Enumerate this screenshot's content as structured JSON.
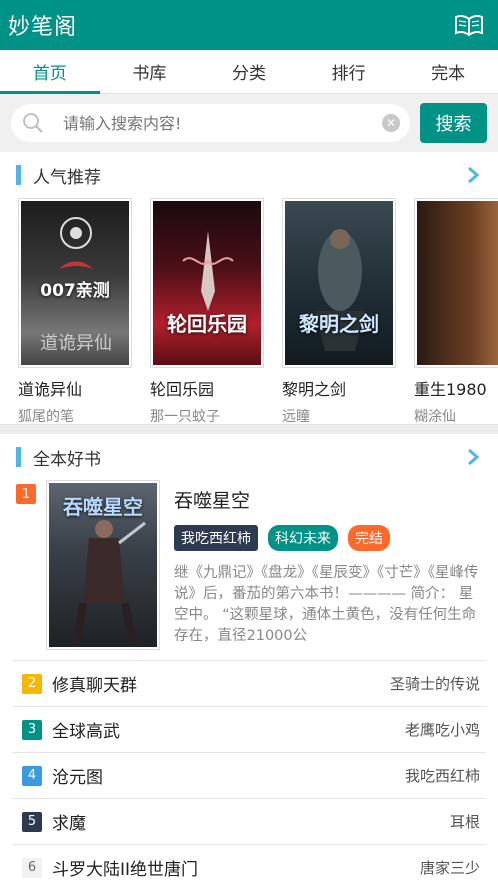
{
  "app": {
    "title": "妙笔阁",
    "library_icon": "open-book-icon"
  },
  "tabs": [
    {
      "label": "首页",
      "active": true
    },
    {
      "label": "书库",
      "active": false
    },
    {
      "label": "分类",
      "active": false
    },
    {
      "label": "排行",
      "active": false
    },
    {
      "label": "完本",
      "active": false
    }
  ],
  "search": {
    "placeholder": "请输入搜索内容!",
    "button_label": "搜索"
  },
  "popular": {
    "heading": "人气推荐",
    "books": [
      {
        "name": "道诡异仙",
        "author": "狐尾的笔",
        "cover_text": "007亲测"
      },
      {
        "name": "轮回乐园",
        "author": "那一只蚊子",
        "cover_text": "轮回乐园"
      },
      {
        "name": "黎明之剑",
        "author": "远瞳",
        "cover_text": "黎明之剑"
      },
      {
        "name": "重生1980",
        "author": "糊涂仙",
        "cover_text": ""
      }
    ]
  },
  "finished": {
    "heading": "全本好书",
    "feature": {
      "rank": "1",
      "title": "吞噬星空",
      "cover_text": "吞噬星空",
      "author_tag": "我吃西红柿",
      "category_tag": "科幻未来",
      "status_tag": "完结",
      "description": "继《九鼎记》《盘龙》《星辰变》《寸芒》《星峰传说》后，番茄的第六本书！———— 简介： 星空中。 “这颗星球，通体土黄色，没有任何生命存在，直径21000公"
    },
    "list": [
      {
        "rank": "2",
        "name": "修真聊天群",
        "author": "圣骑士的传说",
        "color": "#f5b800"
      },
      {
        "rank": "3",
        "name": "全球高武",
        "author": "老鹰吃小鸡",
        "color": "#009187"
      },
      {
        "rank": "4",
        "name": "沧元图",
        "author": "我吃西红柿",
        "color": "#3a9be0"
      },
      {
        "rank": "5",
        "name": "求魔",
        "author": "耳根",
        "color": "#2e3a50"
      },
      {
        "rank": "6",
        "name": "斗罗大陆II绝世唐门",
        "author": "唐家三少",
        "color": "#f2f2f2"
      }
    ]
  }
}
